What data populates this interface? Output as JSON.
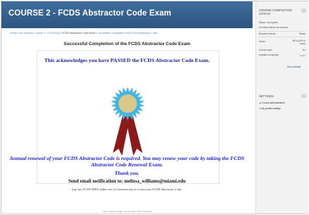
{
  "header": {
    "title": "COURSE 2 - FCDS Abstractor Code Exam"
  },
  "breadcrumb": {
    "items": [
      "Home",
      "My courses",
      "Course 2 - FCDS EQI",
      "FCDS Abstractor Code Exam"
    ],
    "current": "Successful Completion of the FCDS Abstractor Code"
  },
  "main": {
    "heading": "Successful Completion of the FCDS Abstractor Code Exam",
    "certificate": {
      "acknowledgement": "This acknowledges you have PASSED the FCDS Abstractor Code Exam.",
      "renewal": "Annual renewal of your FCDS Abstractor Code is required. You may renew your code by taking the FCDS Abstractor Code Renewal Exam.",
      "thanks": "Thank you.",
      "email_notice": "Send email notification to: melissa_williams@miami.edu",
      "login_notice": "Log into FCDS IDEA within one (1) business day to review your FCDS Abstractor Code."
    },
    "last_modified": "Last modified: Friday, 21 December 2012, 8:19 PM",
    "badge_colors": {
      "rosette": "#45b4e0",
      "center": "#d8c98a",
      "ribbon": "#8b1a1a"
    }
  },
  "sidebar": {
    "completion": {
      "title_line1": "COURSE COMPLETION",
      "title_line2": "STATUS",
      "status": "Status: In progress",
      "note": "All criteria below are required",
      "col_left": "Required criteria",
      "col_right": "Status",
      "rows": [
        {
          "label": "Grade",
          "value": "85% (80% to pass)"
        },
        {
          "label": "Course exam",
          "value": "No"
        },
        {
          "label": "Activities completed",
          "value": "1 of 1"
        }
      ],
      "details_link": "Show details"
    },
    "settings": {
      "title": "SETTINGS",
      "items": [
        "Course administration",
        "My profile settings"
      ]
    }
  }
}
